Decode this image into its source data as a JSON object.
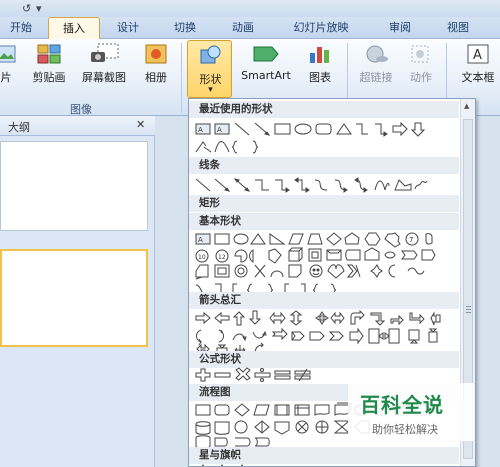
{
  "quick_access": {
    "undo_icon": "undo-icon",
    "redo_glyph": "↺",
    "dropdown_glyph": "▾"
  },
  "tabs": [
    {
      "label": "开始",
      "active": false
    },
    {
      "label": "插入",
      "active": true
    },
    {
      "label": "设计",
      "active": false
    },
    {
      "label": "切换",
      "active": false
    },
    {
      "label": "动画",
      "active": false
    },
    {
      "label": "幻灯片放映",
      "active": false
    },
    {
      "label": "审阅",
      "active": false
    },
    {
      "label": "视图",
      "active": false
    }
  ],
  "ribbon": {
    "images_group": {
      "label": "图像",
      "buttons": [
        "片",
        "剪贴画",
        "屏幕截图",
        "相册"
      ]
    },
    "illustrations": {
      "shapes": "形状",
      "smartart": "SmartArt",
      "chart": "图表"
    },
    "links": {
      "hyperlink": "超链接",
      "action": "动作"
    },
    "text": {
      "textbox": "文本框"
    }
  },
  "left_panel": {
    "outline_tab": "大纲",
    "close_glyph": "✕"
  },
  "shapes_gallery": {
    "categories": [
      {
        "title": "最近使用的形状"
      },
      {
        "title": "线条"
      },
      {
        "title": "矩形"
      },
      {
        "title": "基本形状"
      },
      {
        "title": "箭头总汇"
      },
      {
        "title": "公式形状"
      },
      {
        "title": "流程图"
      },
      {
        "title": "星与旗帜"
      }
    ]
  },
  "watermark": {
    "title": "百科全说",
    "subtitle": "助你轻松解决"
  },
  "colors": {
    "accent": "#d4a02d",
    "ribbon": "#dce7f5",
    "watermark": "#1f8a4c"
  }
}
